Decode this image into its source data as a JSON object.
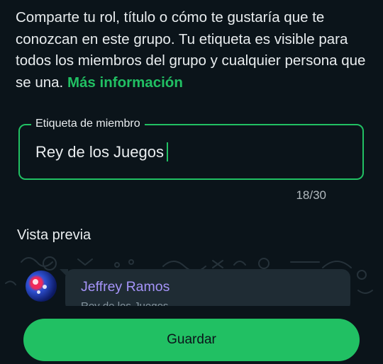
{
  "description": {
    "text": "Comparte tu rol, título o cómo te gustaría que te conozcan en este grupo. Tu etiqueta es visible para todos los miembros del grupo y cualquier persona que se una.",
    "link": "Más información"
  },
  "member_tag_field": {
    "label": "Etiqueta de miembro",
    "value": "Rey de los Juegos",
    "counter": "18/30"
  },
  "preview": {
    "title": "Vista previa",
    "sender_name": "Jeffrey Ramos",
    "tag": "Rey de los Juegos"
  },
  "save_label": "Guardar",
  "colors": {
    "accent": "#21c063",
    "background": "#0b141a",
    "bubble": "#1f2c34",
    "sender_name": "#a594f9"
  }
}
